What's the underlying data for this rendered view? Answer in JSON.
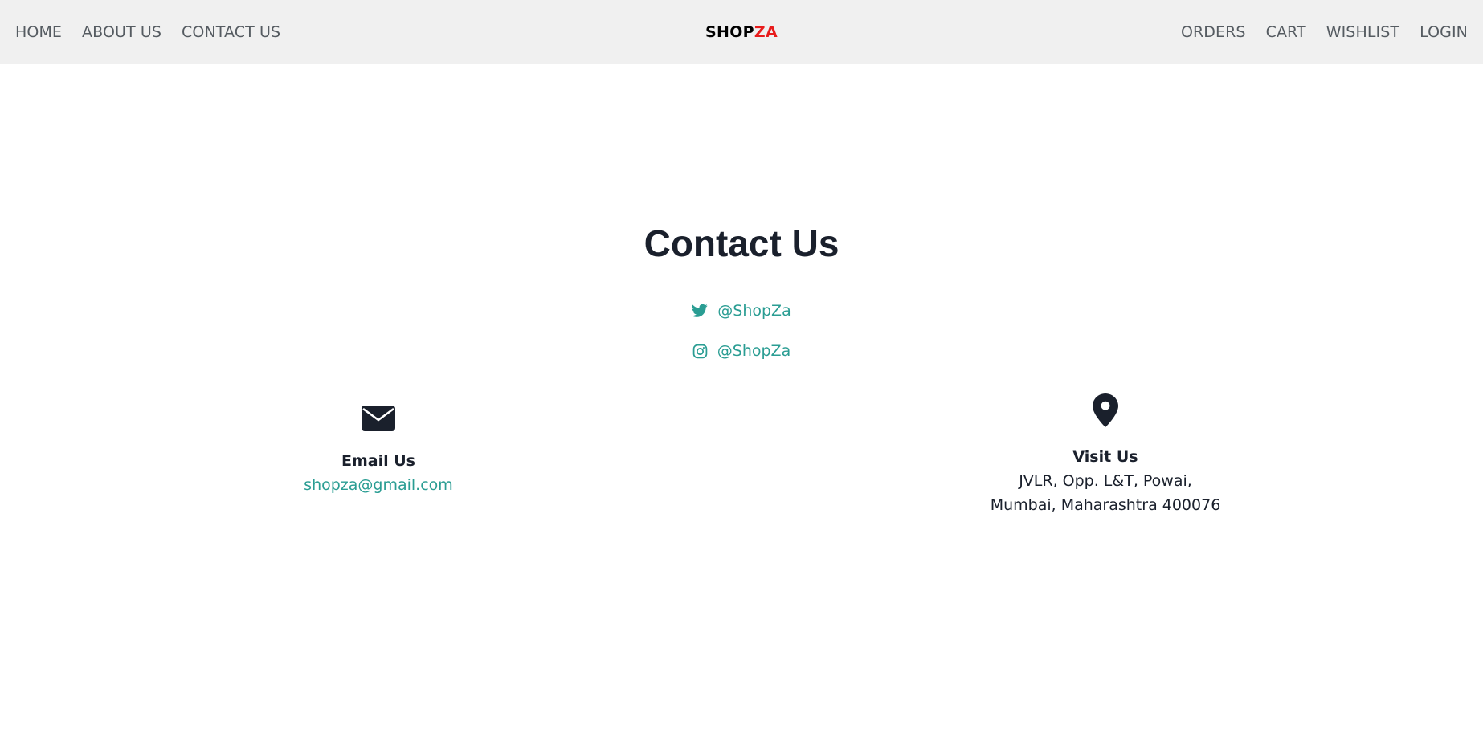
{
  "nav": {
    "left": [
      "HOME",
      "ABOUT US",
      "CONTACT US"
    ],
    "right": [
      "ORDERS",
      "CART",
      "WISHLIST",
      "LOGIN"
    ],
    "brand_part1": "SHOP",
    "brand_part2": "ZA"
  },
  "main": {
    "title": "Contact Us",
    "social": [
      {
        "icon": "twitter-icon",
        "label": "@ShopZa"
      },
      {
        "icon": "instagram-icon",
        "label": "@ShopZa"
      }
    ],
    "email_card": {
      "icon": "envelope-icon",
      "heading": "Email Us",
      "email": "shopza@gmail.com"
    },
    "visit_card": {
      "icon": "map-pin-icon",
      "heading": "Visit Us",
      "address_line1": "JVLR, Opp. L&T, Powai,",
      "address_line2": "Mumbai, Maharashtra 400076"
    }
  },
  "colors": {
    "nav_bg": "#f0f0f0",
    "accent": "#2a9d93",
    "brand_red": "#e81c1c",
    "text_dark": "#1a202c",
    "nav_text": "#555b61"
  }
}
